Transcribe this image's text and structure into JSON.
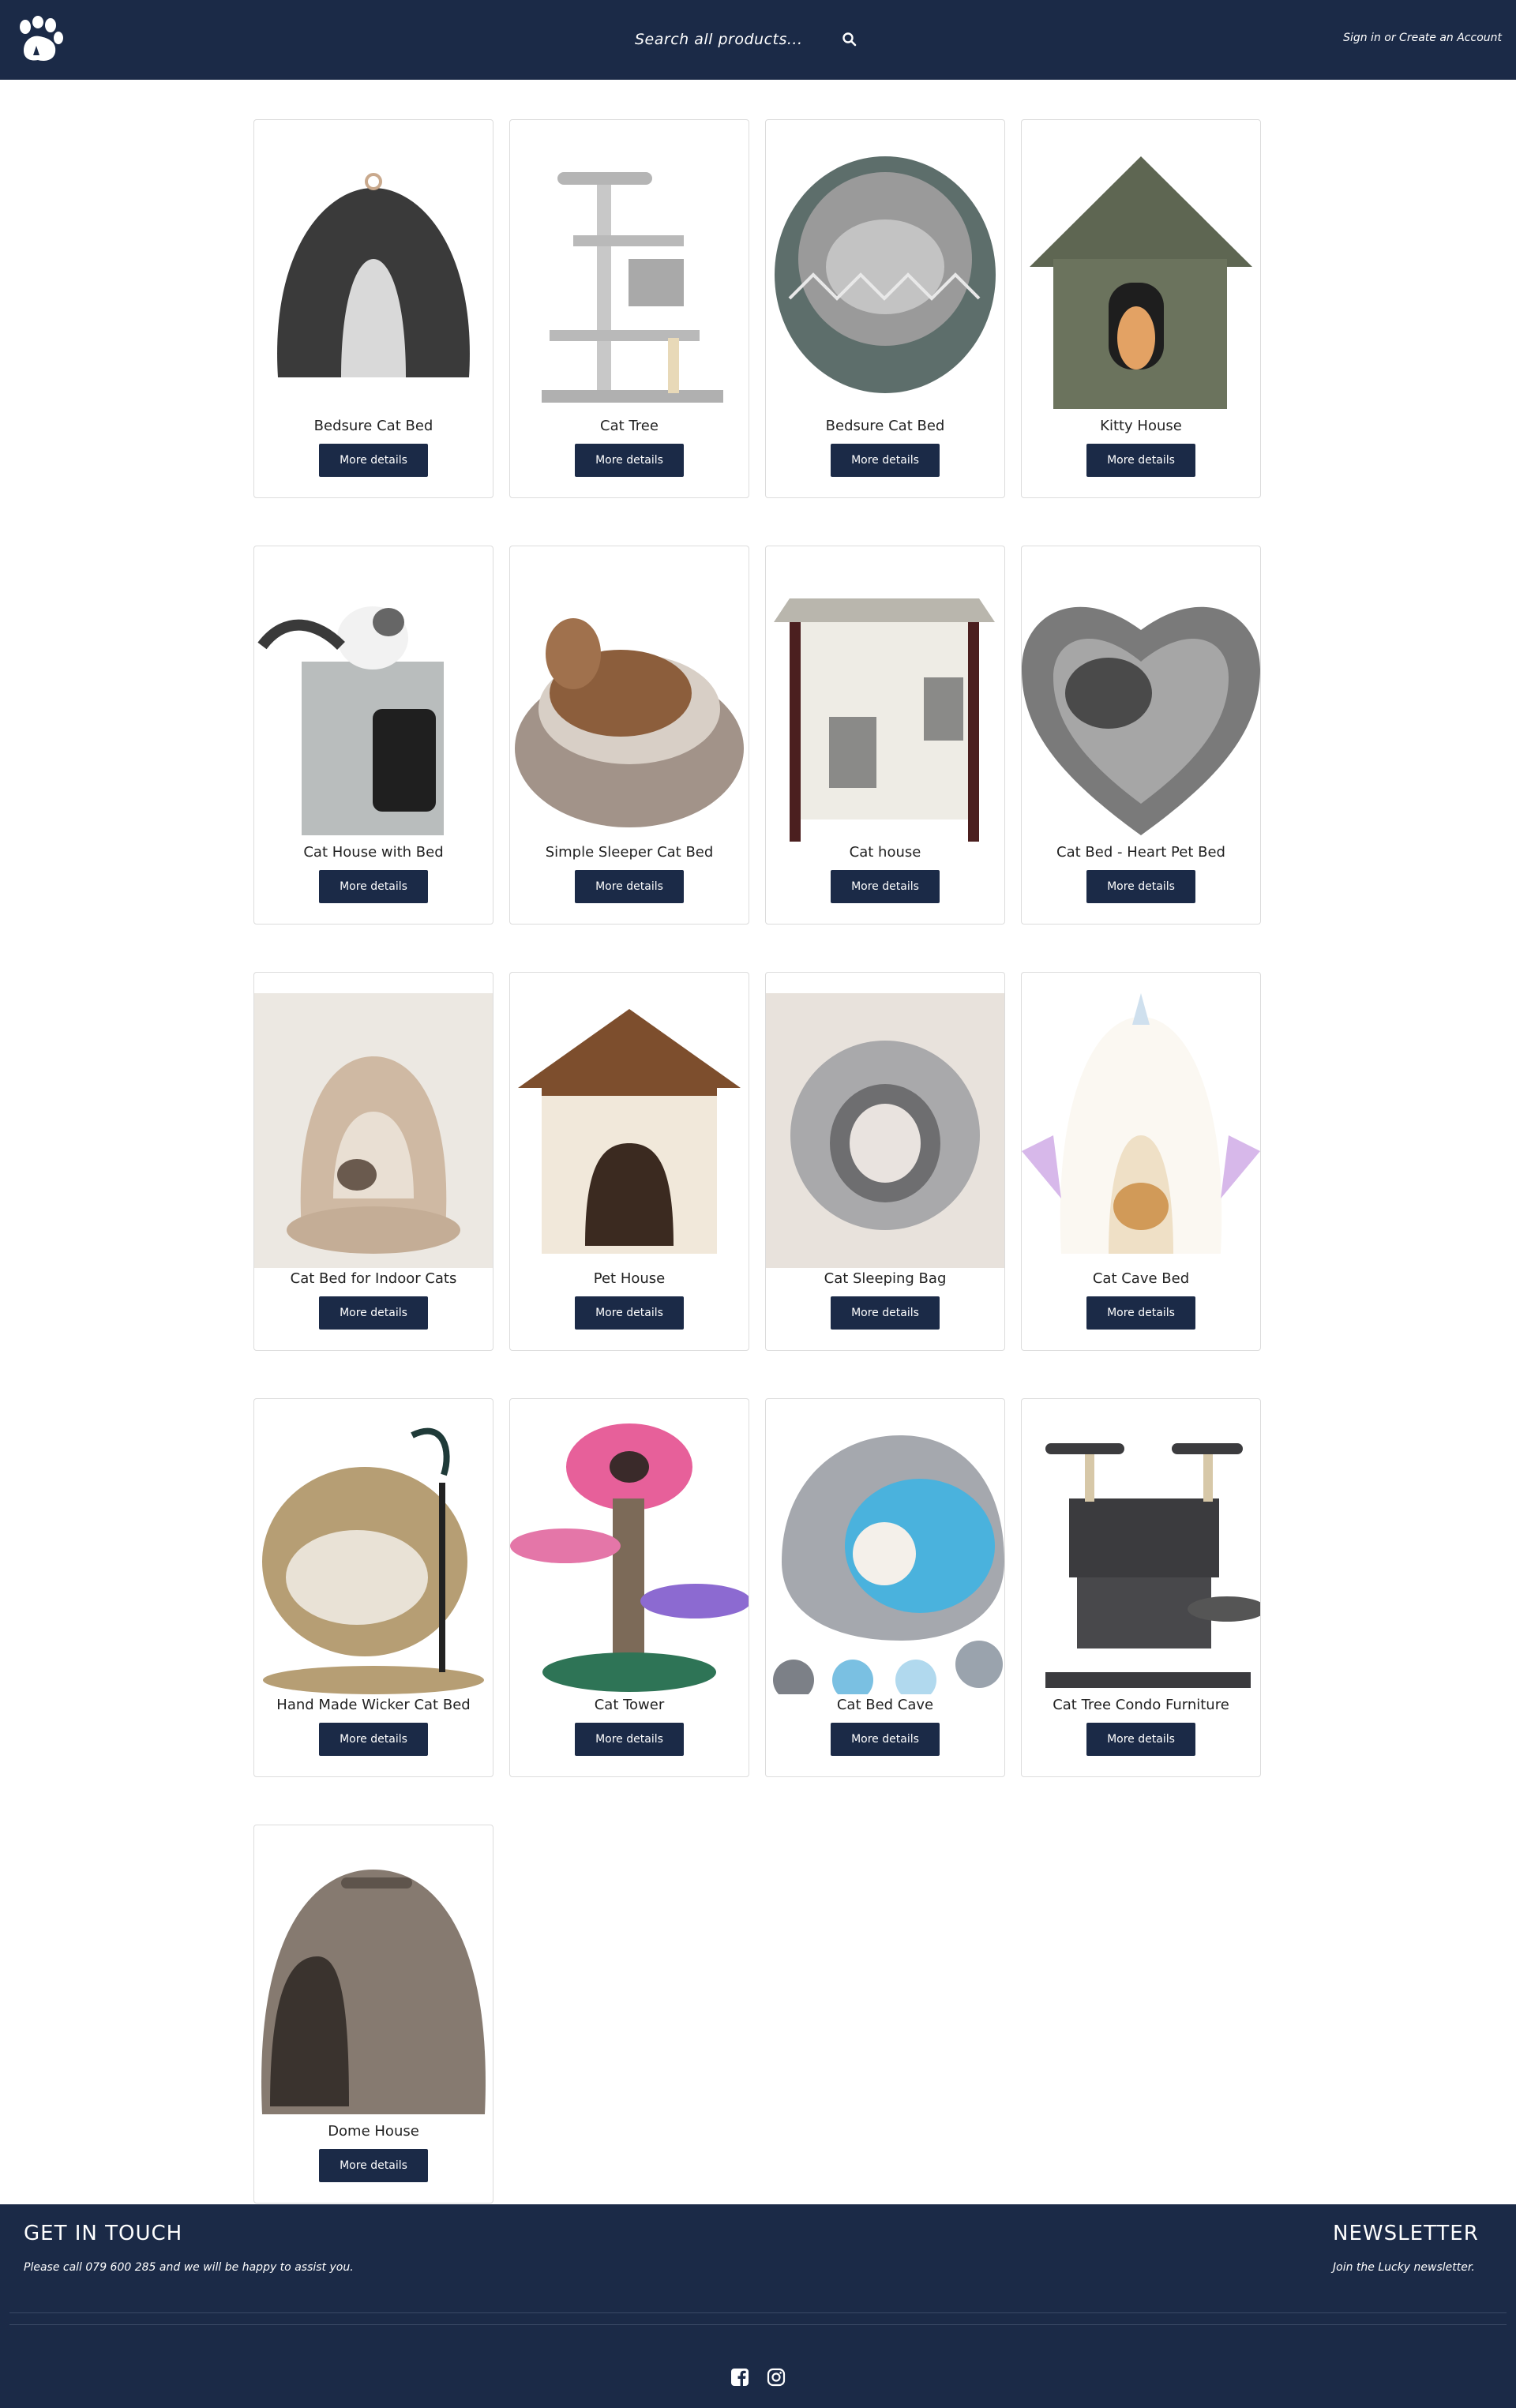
{
  "header": {
    "search_placeholder": "Search all products...",
    "sign_in": "Sign in",
    "or": "or",
    "create_account": "Create an Account"
  },
  "products": [
    {
      "name": "Bedsure Cat Bed",
      "button": "More details",
      "image": "gray-igloo-cat-bed"
    },
    {
      "name": "Cat Tree",
      "button": "More details",
      "image": "gray-cat-tree"
    },
    {
      "name": "Bedsure Cat Bed",
      "button": "More details",
      "image": "round-patterned-cat-bed"
    },
    {
      "name": "Kitty House",
      "button": "More details",
      "image": "green-kitty-house"
    },
    {
      "name": "Cat House with Bed",
      "button": "More details",
      "image": "gray-cube-cat-house"
    },
    {
      "name": "Simple Sleeper Cat Bed",
      "button": "More details",
      "image": "striped-sleeper-bed"
    },
    {
      "name": "Cat house",
      "button": "More details",
      "image": "wooden-cat-house"
    },
    {
      "name": "Cat Bed - Heart Pet Bed",
      "button": "More details",
      "image": "heart-pet-bed"
    },
    {
      "name": "Cat Bed for Indoor Cats",
      "button": "More details",
      "image": "beige-cave-bed"
    },
    {
      "name": "Pet House",
      "button": "More details",
      "image": "brown-pet-house"
    },
    {
      "name": "Cat Sleeping Bag",
      "button": "More details",
      "image": "fluffy-sleeping-bag"
    },
    {
      "name": "Cat Cave Bed",
      "button": "More details",
      "image": "unicorn-cave-bed"
    },
    {
      "name": "Hand Made Wicker Cat Bed",
      "button": "More details",
      "image": "wicker-hanging-bed"
    },
    {
      "name": "Cat Tower",
      "button": "More details",
      "image": "mushroom-cat-tower"
    },
    {
      "name": "Cat Bed Cave",
      "button": "More details",
      "image": "felt-cave-bed"
    },
    {
      "name": "Cat Tree Condo Furniture",
      "button": "More details",
      "image": "condo-cat-tree"
    },
    {
      "name": "Dome House",
      "button": "More details",
      "image": "dome-litter-house"
    }
  ],
  "footer": {
    "contact_title": "GET IN TOUCH",
    "contact_text": "Please call 079 600 285 and we will be happy to assist you.",
    "newsletter_title": "NEWSLETTER",
    "newsletter_text": "Join the Lucky newsletter."
  },
  "colors": {
    "brand_navy": "#1b2a47"
  }
}
